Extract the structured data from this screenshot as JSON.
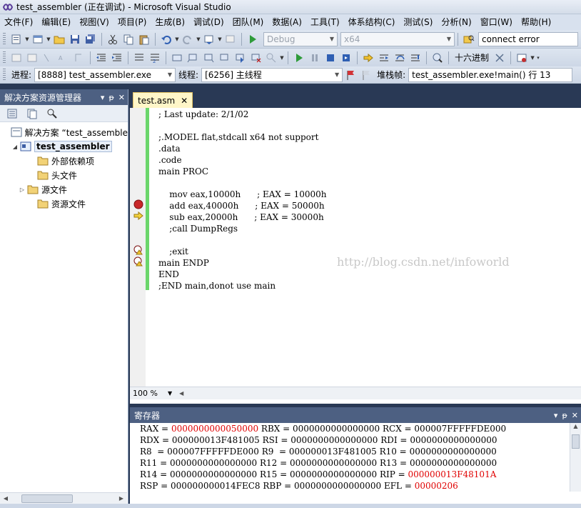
{
  "window": {
    "title": "test_assembler (正在调试) - Microsoft Visual Studio"
  },
  "menu": [
    "文件(F)",
    "编辑(E)",
    "视图(V)",
    "项目(P)",
    "生成(B)",
    "调试(D)",
    "团队(M)",
    "数据(A)",
    "工具(T)",
    "体系结构(C)",
    "测试(S)",
    "分析(N)",
    "窗口(W)",
    "帮助(H)"
  ],
  "toolbar1": {
    "config": "Debug",
    "platform": "x64",
    "find_value": "connect error"
  },
  "toolbar2": {
    "hex_label": "十六进制"
  },
  "toolbar3": {
    "process_label": "进程:",
    "process_value": "[8888] test_assembler.exe",
    "thread_label": "线程:",
    "thread_value": "[6256] 主线程",
    "stackframe_label": "堆栈帧:",
    "stackframe_value": "test_assembler.exe!main()  行 13"
  },
  "solution_explorer": {
    "title": "解决方案资源管理器",
    "solution": "解决方案 “test_assemble",
    "project": "test_assembler",
    "items": [
      "外部依赖项",
      "头文件",
      "源文件",
      "资源文件"
    ]
  },
  "editor": {
    "tab_label": "test.asm",
    "lines": [
      "; Last update: 2/1/02",
      "",
      ";.MODEL flat,stdcall x64 not support",
      ".data",
      ".code",
      "main PROC",
      "",
      "    mov eax,10000h      ; EAX = 10000h",
      "    add eax,40000h      ; EAX = 50000h",
      "    sub eax,20000h      ; EAX = 30000h",
      "    ;call DumpRegs",
      "",
      "    ;exit",
      "main ENDP",
      "END",
      ";END main,donot use main"
    ],
    "watermark": "http://blog.csdn.net/infoworld",
    "zoom": "100 %"
  },
  "registers": {
    "title": "寄存器",
    "rows": [
      [
        [
          "RAX = ",
          "0000000000050000",
          true
        ],
        [
          " RBX = ",
          "0000000000000000",
          false
        ],
        [
          " RCX = ",
          "000007FFFFFDE000",
          false
        ]
      ],
      [
        [
          "RDX = ",
          "000000013F481005",
          false
        ],
        [
          " RSI = ",
          "0000000000000000",
          false
        ],
        [
          " RDI = ",
          "0000000000000000",
          false
        ]
      ],
      [
        [
          "R8  = ",
          "000007FFFFFDE000",
          false
        ],
        [
          " R9  = ",
          "000000013F481005",
          false
        ],
        [
          " R10 = ",
          "0000000000000000",
          false
        ]
      ],
      [
        [
          "R11 = ",
          "0000000000000000",
          false
        ],
        [
          " R12 = ",
          "0000000000000000",
          false
        ],
        [
          " R13 = ",
          "0000000000000000",
          false
        ]
      ],
      [
        [
          "R14 = ",
          "0000000000000000",
          false
        ],
        [
          " R15 = ",
          "0000000000000000",
          false
        ],
        [
          " RIP = ",
          "000000013F48101A",
          true
        ]
      ],
      [
        [
          "RSP = ",
          "000000000014FEC8",
          false
        ],
        [
          " RBP = ",
          "0000000000000000",
          false
        ],
        [
          " EFL = ",
          "00000206",
          true
        ]
      ]
    ]
  },
  "colors": {
    "changed": "#e00000",
    "panel_header": "#4d6082",
    "background": "#293955"
  }
}
